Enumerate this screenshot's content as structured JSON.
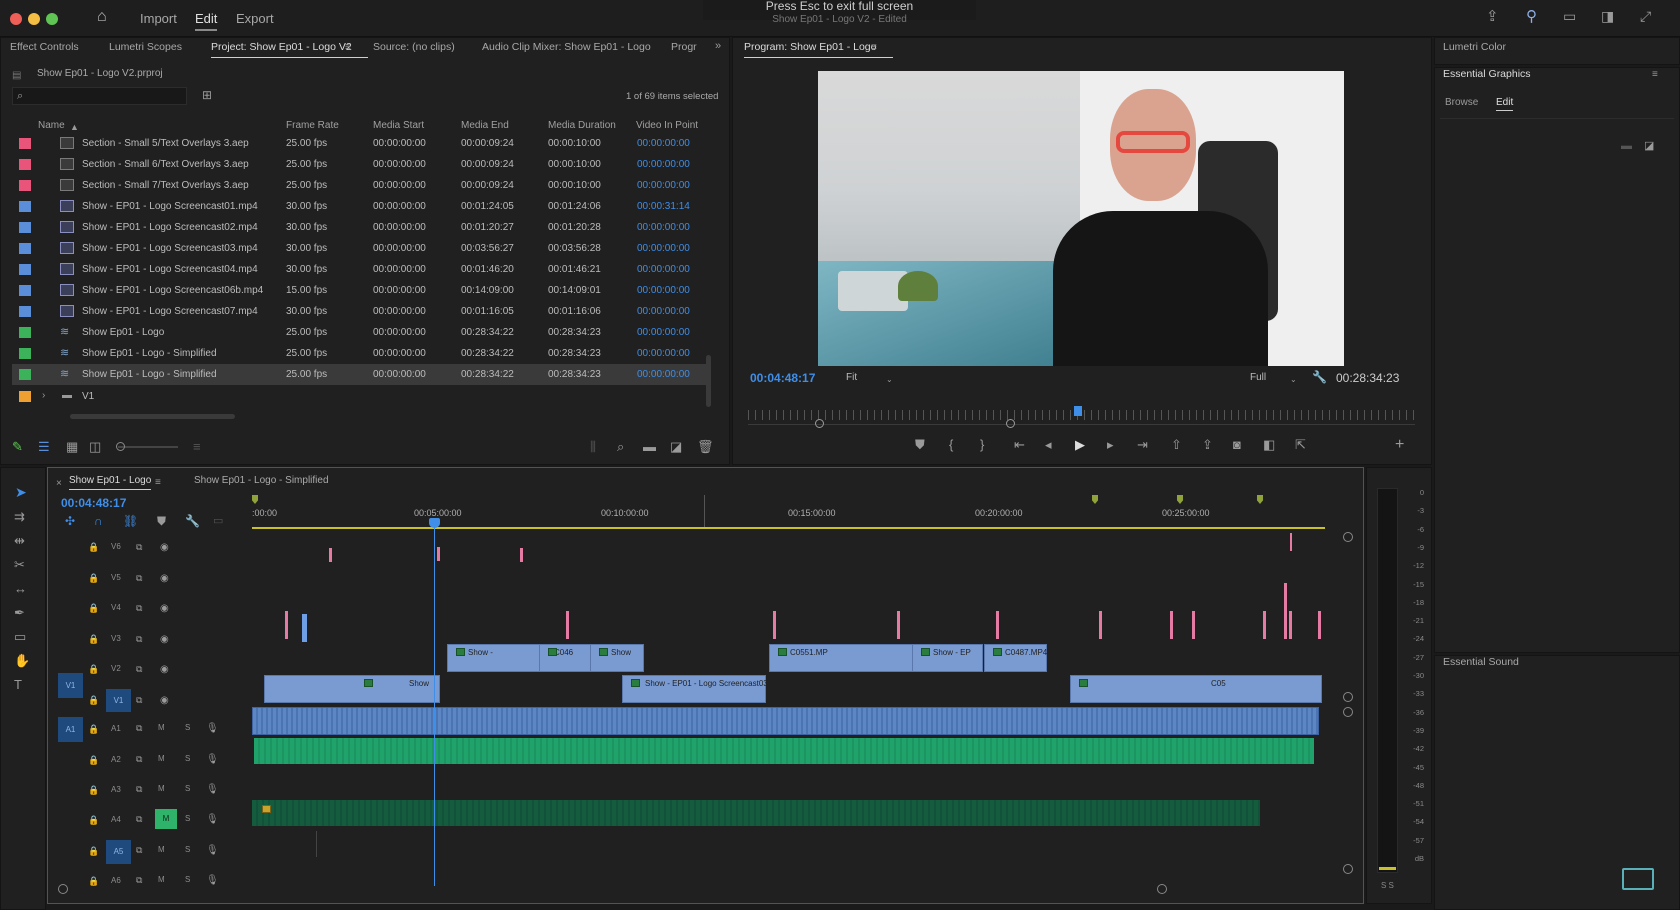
{
  "topbar": {
    "nav": [
      "Import",
      "Edit",
      "Export"
    ],
    "active_nav": "Edit",
    "tip_text": "Press Esc to exit full screen",
    "project_title": "Show Ep01 - Logo V2 - Edited"
  },
  "left_tabs": [
    "Effect Controls",
    "Lumetri Scopes",
    "Project: Show Ep01 - Logo V2",
    "Source: (no clips)",
    "Audio Clip Mixer: Show Ep01 - Logo",
    "Progr"
  ],
  "project": {
    "file": "Show Ep01 - Logo V2.prproj",
    "items_selected": "1 of 69 items selected",
    "columns": [
      "Name",
      "Frame Rate",
      "Media Start",
      "Media End",
      "Media Duration",
      "Video In Point"
    ],
    "rows": [
      {
        "color": "#e9557a",
        "kind": "aep",
        "name": "Section - Small 5/Text Overlays 3.aep",
        "fps": "25.00 fps",
        "start": "00:00:00:00",
        "end": "00:00:09:24",
        "dur": "00:00:10:00",
        "vin": "00:00:00:00"
      },
      {
        "color": "#e9557a",
        "kind": "aep",
        "name": "Section - Small 6/Text Overlays 3.aep",
        "fps": "25.00 fps",
        "start": "00:00:00:00",
        "end": "00:00:09:24",
        "dur": "00:00:10:00",
        "vin": "00:00:00:00"
      },
      {
        "color": "#e9557a",
        "kind": "aep",
        "name": "Section - Small 7/Text Overlays 3.aep",
        "fps": "25.00 fps",
        "start": "00:00:00:00",
        "end": "00:00:09:24",
        "dur": "00:00:10:00",
        "vin": "00:00:00:00"
      },
      {
        "color": "#5a8ed8",
        "kind": "vid",
        "name": "Show - EP01 - Logo Screencast01.mp4",
        "fps": "30.00 fps",
        "start": "00:00:00:00",
        "end": "00:01:24:05",
        "dur": "00:01:24:06",
        "vin": "00:00:31:14"
      },
      {
        "color": "#5a8ed8",
        "kind": "vid",
        "name": "Show - EP01 - Logo Screencast02.mp4",
        "fps": "30.00 fps",
        "start": "00:00:00:00",
        "end": "00:01:20:27",
        "dur": "00:01:20:28",
        "vin": "00:00:00:00"
      },
      {
        "color": "#5a8ed8",
        "kind": "vid",
        "name": "Show - EP01 - Logo Screencast03.mp4",
        "fps": "30.00 fps",
        "start": "00:00:00:00",
        "end": "00:03:56:27",
        "dur": "00:03:56:28",
        "vin": "00:00:00:00"
      },
      {
        "color": "#5a8ed8",
        "kind": "vid",
        "name": "Show - EP01 - Logo Screencast04.mp4",
        "fps": "30.00 fps",
        "start": "00:00:00:00",
        "end": "00:01:46:20",
        "dur": "00:01:46:21",
        "vin": "00:00:00:00"
      },
      {
        "color": "#5a8ed8",
        "kind": "vid",
        "name": "Show - EP01 - Logo Screencast06b.mp4",
        "fps": "15.00 fps",
        "start": "00:00:00:00",
        "end": "00:14:09:00",
        "dur": "00:14:09:01",
        "vin": "00:00:00:00"
      },
      {
        "color": "#5a8ed8",
        "kind": "vid",
        "name": "Show - EP01 - Logo Screencast07.mp4",
        "fps": "30.00 fps",
        "start": "00:00:00:00",
        "end": "00:01:16:05",
        "dur": "00:01:16:06",
        "vin": "00:00:00:00"
      },
      {
        "color": "#3cb35a",
        "kind": "seq",
        "name": "Show Ep01 - Logo",
        "fps": "25.00 fps",
        "start": "00:00:00:00",
        "end": "00:28:34:22",
        "dur": "00:28:34:23",
        "vin": "00:00:00:00"
      },
      {
        "color": "#3cb35a",
        "kind": "seq",
        "name": "Show Ep01 - Logo - Simplified",
        "fps": "25.00 fps",
        "start": "00:00:00:00",
        "end": "00:28:34:22",
        "dur": "00:28:34:23",
        "vin": "00:00:00:00"
      },
      {
        "color": "#3cb35a",
        "kind": "seq",
        "name": "Show Ep01 - Logo - Simplified",
        "fps": "25.00 fps",
        "start": "00:00:00:00",
        "end": "00:28:34:22",
        "dur": "00:28:34:23",
        "vin": "00:00:00:00"
      }
    ],
    "folder": {
      "color": "#f0a030",
      "name": "V1"
    }
  },
  "program": {
    "title": "Program: Show Ep01 - Logo",
    "timecode": "00:04:48:17",
    "fit": "Fit",
    "quality": "Full",
    "duration": "00:28:34:23"
  },
  "right": {
    "lumetri": "Lumetri Color",
    "eg_title": "Essential Graphics",
    "browse": "Browse",
    "edit": "Edit",
    "sound": "Essential Sound"
  },
  "timeline": {
    "tabs": [
      "Show Ep01 - Logo",
      "Show Ep01 - Logo - Simplified"
    ],
    "timecode": "00:04:48:17",
    "ticks": [
      ":00:00",
      "00:05:00:00",
      "00:10:00:00",
      "00:15:00:00",
      "00:20:00:00",
      "00:25:00:00"
    ],
    "video_tracks": [
      "V6",
      "V5",
      "V4",
      "V3",
      "V2",
      "V1"
    ],
    "audio_tracks": [
      "A1",
      "A2",
      "A3",
      "A4",
      "A5",
      "A6"
    ],
    "clip_labels": [
      "Show -",
      "C046",
      "Show",
      "Show",
      "Show - EP01 - Logo Screencast03.",
      "C0551.MP",
      "Show - EP",
      "C0487.MP4 [",
      "C05"
    ],
    "meter_scale": [
      "0",
      "-3",
      "-6",
      "-9",
      "-12",
      "-15",
      "-18",
      "-21",
      "-24",
      "-27",
      "-30",
      "-33",
      "-36",
      "-39",
      "-42",
      "-45",
      "-48",
      "-51",
      "-54",
      "-57",
      "dB"
    ],
    "meter_footer": "S S"
  }
}
